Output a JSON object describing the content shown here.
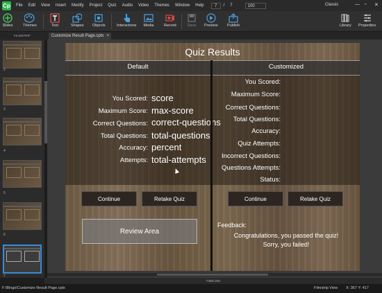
{
  "menubar": {
    "logo": "Cp",
    "items": [
      "File",
      "Edit",
      "View",
      "Insert",
      "Modify",
      "Project",
      "Quiz",
      "Audio",
      "Video",
      "Themes",
      "Window",
      "Help"
    ],
    "page_current": "7",
    "page_sep": "/",
    "page_total": "7",
    "zoom": "100",
    "workspace": "Classic"
  },
  "toolbar": {
    "slides": "Slides",
    "themes": "Themes",
    "text": "Text",
    "shapes": "Shapes",
    "objects": "Objects",
    "interactions": "Interactions",
    "media": "Media",
    "record": "Record",
    "save": "Save",
    "preview": "Preview",
    "publish": "Publish",
    "library": "Library",
    "properties": "Properties"
  },
  "tabs": {
    "filmstrip_label": "FILMSTRIP",
    "document": "Customize Result Page.cptx",
    "close": "×"
  },
  "filmstrip": {
    "slide_numbers": [
      "2",
      "3",
      "4",
      "5",
      "6",
      "7"
    ]
  },
  "slide": {
    "title": "Quiz Results",
    "default_header": "Default",
    "customized_header": "Customized",
    "default_rows": [
      {
        "label": "You Scored:",
        "value": "score"
      },
      {
        "label": "Maximum Score:",
        "value": "max-score"
      },
      {
        "label": "Correct Questions:",
        "value": "correct-questions"
      },
      {
        "label": "Total Questions:",
        "value": "total-questions"
      },
      {
        "label": "Accuracy:",
        "value": "percent"
      },
      {
        "label": "Attempts:",
        "value": "total-attempts"
      }
    ],
    "custom_rows": [
      "You Scored:",
      "Maximum Score:",
      "Correct Questions:",
      "Total Questions:",
      "Accuracy:",
      "Quiz Attempts:",
      "Incorrect Questions:",
      "Questions Attempts:",
      "Status:"
    ],
    "buttons": {
      "continue_left": "Continue",
      "retake_left": "Retake Quiz",
      "continue_right": "Continue",
      "retake_right": "Retake Quiz",
      "review": "Review Area"
    },
    "feedback_label": "Feedback:",
    "pass_message": "Congratulations, you passed the quiz!",
    "fail_message": "Sorry, you failed!"
  },
  "timeline": "TIMELINE",
  "status": {
    "path": "F:\\Blogs\\Customize Result Page.cptx",
    "view": "Filmstrip View",
    "coords": "X: 367 Y: 417"
  },
  "colors": {
    "accent": "#2db34a",
    "selection": "#3b8bd8",
    "panel": "#303030"
  }
}
